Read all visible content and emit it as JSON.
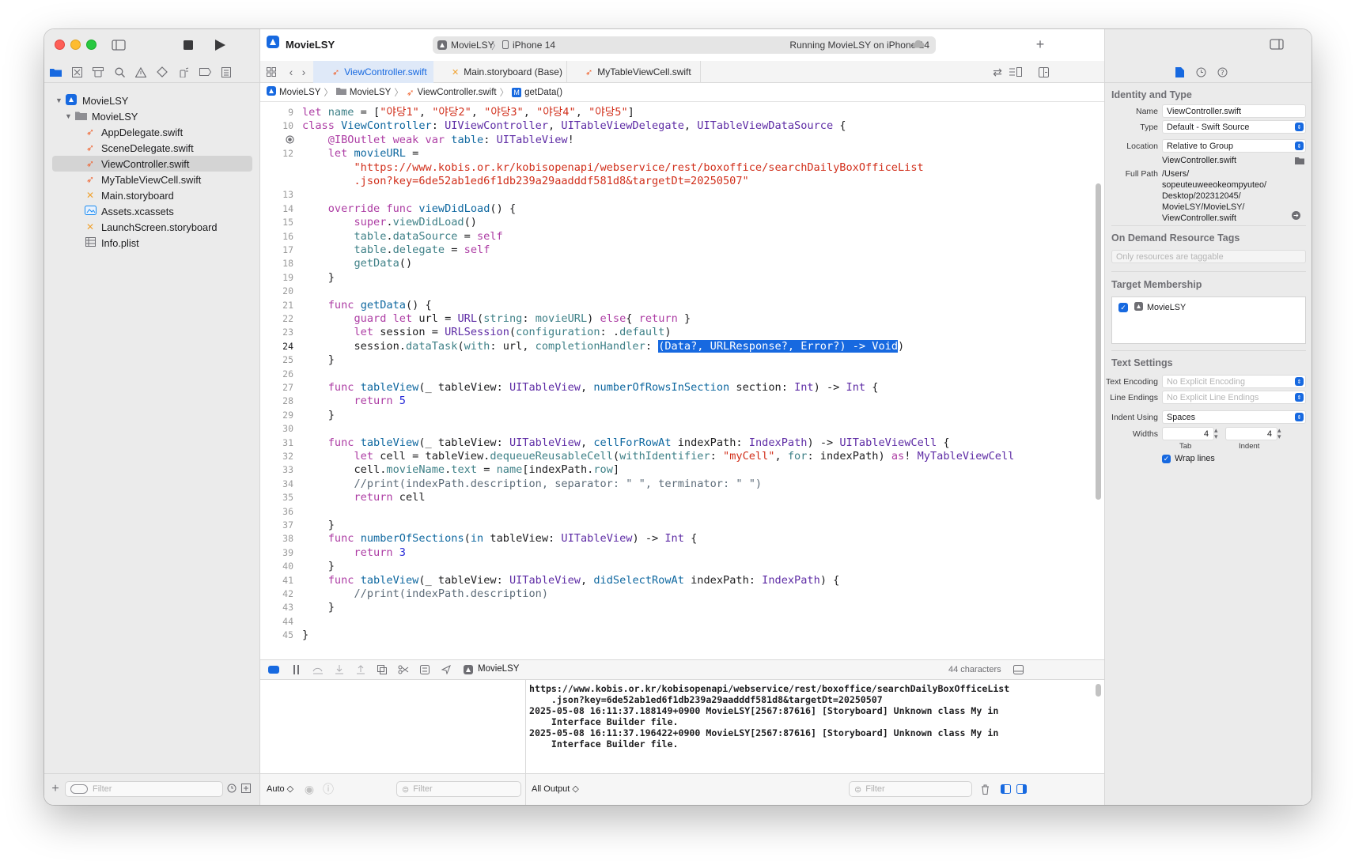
{
  "toolbar": {
    "project_name": "MovieLSY",
    "scheme_target": "MovieLSY",
    "scheme_device": "iPhone 14",
    "status": "Running MovieLSY on iPhone 14"
  },
  "navigator": {
    "items": [
      {
        "label": "MovieLSY",
        "icon": "project-icon"
      },
      {
        "label": "MovieLSY",
        "icon": "folder-icon"
      },
      {
        "label": "AppDelegate.swift",
        "icon": "swift-file-icon"
      },
      {
        "label": "SceneDelegate.swift",
        "icon": "swift-file-icon"
      },
      {
        "label": "ViewController.swift",
        "icon": "swift-file-icon"
      },
      {
        "label": "MyTableViewCell.swift",
        "icon": "swift-file-icon"
      },
      {
        "label": "Main.storyboard",
        "icon": "storyboard-icon"
      },
      {
        "label": "Assets.xcassets",
        "icon": "assets-icon"
      },
      {
        "label": "LaunchScreen.storyboard",
        "icon": "storyboard-icon"
      },
      {
        "label": "Info.plist",
        "icon": "plist-icon"
      }
    ],
    "filter_placeholder": "Filter"
  },
  "tabs": [
    {
      "label": "ViewController.swift"
    },
    {
      "label": "Main.storyboard (Base)"
    },
    {
      "label": "MyTableViewCell.swift"
    }
  ],
  "jumpbar": [
    "MovieLSY",
    "MovieLSY",
    "ViewController.swift",
    "getData()"
  ],
  "code": [
    {
      "n": "9",
      "html": "<span class=\"kw\">let</span> <span class=\"pr\">name</span> = [<span class=\"str\">\"야당1\"</span>, <span class=\"str\">\"야당2\"</span>, <span class=\"str\">\"야당3\"</span>, <span class=\"str\">\"야당4\"</span>, <span class=\"str\">\"야당5\"</span>]"
    },
    {
      "n": "10",
      "html": "<span class=\"kw\">class</span> <span class=\"fn\">ViewController</span>: <span class=\"ty\">UIViewController</span>, <span class=\"ty\">UITableViewDelegate</span>, <span class=\"ty\">UITableViewDataSource</span> {"
    },
    {
      "n": "",
      "html": "    <span class=\"kw\">@IBOutlet</span> <span class=\"kw\">weak</span> <span class=\"kw\">var</span> <span class=\"fn\">table</span>: <span class=\"ty\">UITableView</span>!"
    },
    {
      "n": "12",
      "html": "    <span class=\"kw\">let</span> <span class=\"fn\">movieURL</span> ="
    },
    {
      "n": "",
      "html": "        <span class=\"str\">\"https://www.kobis.or.kr/kobisopenapi/webservice/rest/boxoffice/searchDailyBoxOfficeList</span>"
    },
    {
      "n": "",
      "html": "        <span class=\"str\">.json?key=6de52ab1ed6f1db239a29aadddf581d8&amp;targetDt=20250507\"</span>"
    },
    {
      "n": "13",
      "html": ""
    },
    {
      "n": "14",
      "html": "    <span class=\"kw\">override</span> <span class=\"kw\">func</span> <span class=\"fn\">viewDidLoad</span>() {"
    },
    {
      "n": "15",
      "html": "        <span class=\"kw\">super</span>.<span class=\"pr\">viewDidLoad</span>()"
    },
    {
      "n": "16",
      "html": "        <span class=\"pr\">table</span>.<span class=\"pr\">dataSource</span> = <span class=\"kw\">self</span>"
    },
    {
      "n": "17",
      "html": "        <span class=\"pr\">table</span>.<span class=\"pr\">delegate</span> = <span class=\"kw\">self</span>"
    },
    {
      "n": "18",
      "html": "        <span class=\"pr\">getData</span>()"
    },
    {
      "n": "19",
      "html": "    }"
    },
    {
      "n": "20",
      "html": ""
    },
    {
      "n": "21",
      "html": "    <span class=\"kw\">func</span> <span class=\"fn\">getData</span>() {"
    },
    {
      "n": "22",
      "html": "        <span class=\"kw\">guard</span> <span class=\"kw\">let</span> url = <span class=\"ty\">URL</span>(<span class=\"pr\">string</span>: <span class=\"pr\">movieURL</span>) <span class=\"kw\">else</span>{ <span class=\"kw\">return</span> }"
    },
    {
      "n": "23",
      "html": "        <span class=\"kw\">let</span> session = <span class=\"ty\">URLSession</span>(<span class=\"pr\">configuration</span>: .<span class=\"pr\">default</span>)"
    },
    {
      "n": "24",
      "html": "        session.<span class=\"pr\">dataTask</span>(<span class=\"pr\">with</span>: url, <span class=\"pr\">completionHandler</span>: <span class=\"sel\">(Data?, URLResponse?, Error?) -&gt; Void</span>)",
      "current": true
    },
    {
      "n": "25",
      "html": "    }"
    },
    {
      "n": "26",
      "html": ""
    },
    {
      "n": "27",
      "html": "    <span class=\"kw\">func</span> <span class=\"fn\">tableView</span>(_ tableView: <span class=\"ty\">UITableView</span>, <span class=\"fn\">numberOfRowsInSection</span> section: <span class=\"ty\">Int</span>) -&gt; <span class=\"ty\">Int</span> {"
    },
    {
      "n": "28",
      "html": "        <span class=\"kw\">return</span> <span class=\"num\">5</span>"
    },
    {
      "n": "29",
      "html": "    }"
    },
    {
      "n": "30",
      "html": ""
    },
    {
      "n": "31",
      "html": "    <span class=\"kw\">func</span> <span class=\"fn\">tableView</span>(_ tableView: <span class=\"ty\">UITableView</span>, <span class=\"fn\">cellForRowAt</span> indexPath: <span class=\"ty\">IndexPath</span>) -&gt; <span class=\"ty\">UITableViewCell</span> {"
    },
    {
      "n": "32",
      "html": "        <span class=\"kw\">let</span> cell = tableView.<span class=\"pr\">dequeueReusableCell</span>(<span class=\"pr\">withIdentifier</span>: <span class=\"str\">\"myCell\"</span>, <span class=\"pr\">for</span>: indexPath) <span class=\"kw\">as</span>! <span class=\"ty\">MyTableViewCell</span>"
    },
    {
      "n": "33",
      "html": "        cell.<span class=\"pr\">movieName</span>.<span class=\"pr\">text</span> = <span class=\"pr\">name</span>[indexPath.<span class=\"pr\">row</span>]"
    },
    {
      "n": "34",
      "html": "        <span class=\"cm\">//print(indexPath.description, separator: \" \", terminator: \" \")</span>"
    },
    {
      "n": "35",
      "html": "        <span class=\"kw\">return</span> cell"
    },
    {
      "n": "36",
      "html": ""
    },
    {
      "n": "37",
      "html": "    }"
    },
    {
      "n": "38",
      "html": "    <span class=\"kw\">func</span> <span class=\"fn\">numberOfSections</span>(<span class=\"fn\">in</span> tableView: <span class=\"ty\">UITableView</span>) -&gt; <span class=\"ty\">Int</span> {"
    },
    {
      "n": "39",
      "html": "        <span class=\"kw\">return</span> <span class=\"num\">3</span>"
    },
    {
      "n": "40",
      "html": "    }"
    },
    {
      "n": "41",
      "html": "    <span class=\"kw\">func</span> <span class=\"fn\">tableView</span>(_ tableView: <span class=\"ty\">UITableView</span>, <span class=\"fn\">didSelectRowAt</span> indexPath: <span class=\"ty\">IndexPath</span>) {"
    },
    {
      "n": "42",
      "html": "        <span class=\"cm\">//print(indexPath.description)</span>"
    },
    {
      "n": "43",
      "html": "    }"
    },
    {
      "n": "44",
      "html": ""
    },
    {
      "n": "45",
      "html": "}"
    }
  ],
  "debug": {
    "target": "MovieLSY",
    "char_count": "44 characters",
    "console_lines": [
      "https://www.kobis.or.kr/kobisopenapi/webservice/rest/boxoffice/searchDailyBoxOfficeList",
      "    .json?key=6de52ab1ed6f1db239a29aadddf581d8&targetDt=20250507",
      "2025-05-08 16:11:37.188149+0900 MovieLSY[2567:87616] [Storyboard] Unknown class My in",
      "    Interface Builder file.",
      "2025-05-08 16:11:37.196422+0900 MovieLSY[2567:87616] [Storyboard] Unknown class My in",
      "    Interface Builder file."
    ],
    "auto_label": "Auto ◇",
    "output_label": "All Output ◇",
    "filter_placeholder": "Filter"
  },
  "inspector": {
    "identity_heading": "Identity and Type",
    "name_label": "Name",
    "name_value": "ViewController.swift",
    "type_label": "Type",
    "type_value": "Default - Swift Source",
    "location_label": "Location",
    "location_value": "Relative to Group",
    "location_file": "ViewController.swift",
    "fullpath_label": "Full Path",
    "fullpath_lines": [
      "/Users/",
      "sopeuteuweeokeompyuteo/",
      "Desktop/202312045/",
      "MovieLSY/MovieLSY/",
      "ViewController.swift"
    ],
    "odr_heading": "On Demand Resource Tags",
    "odr_placeholder": "Only resources are taggable",
    "target_heading": "Target Membership",
    "target_item": "MovieLSY",
    "text_heading": "Text Settings",
    "encoding_label": "Text Encoding",
    "encoding_value": "No Explicit Encoding",
    "endings_label": "Line Endings",
    "endings_value": "No Explicit Line Endings",
    "indent_label": "Indent Using",
    "indent_value": "Spaces",
    "widths_label": "Widths",
    "tab_value": "4",
    "indent_width_value": "4",
    "tab_caption": "Tab",
    "indent_caption": "Indent",
    "wrap_label": "Wrap lines"
  },
  "colors": {
    "accent": "#1769e0",
    "swift": "#f0622d",
    "keyword": "#ad3da4",
    "string": "#d12f1b"
  }
}
